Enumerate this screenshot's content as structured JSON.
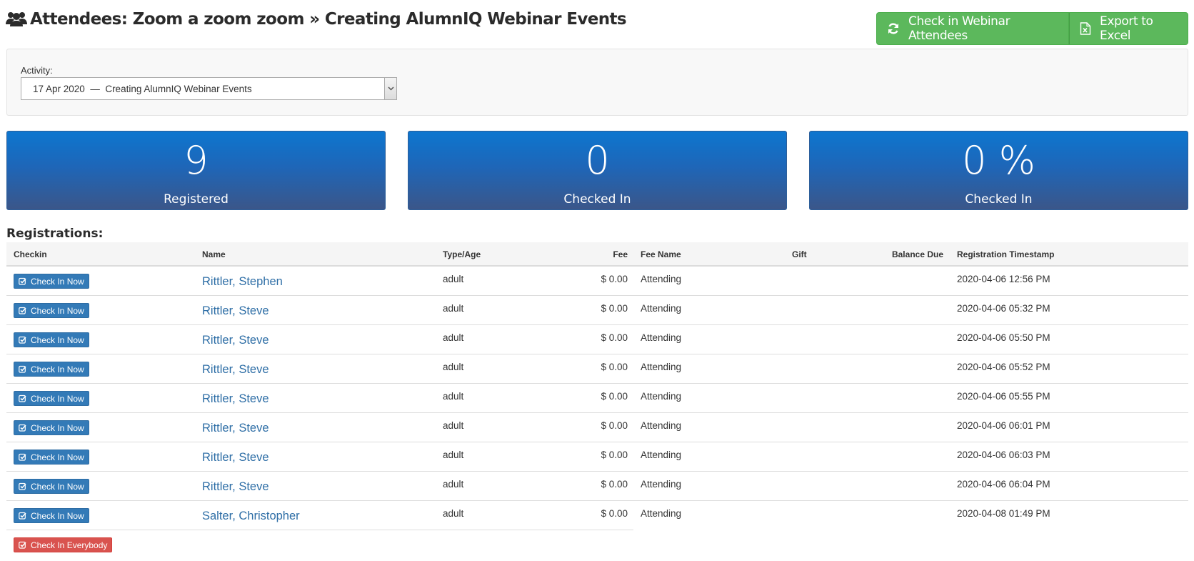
{
  "page": {
    "title": "Attendees: Zoom a zoom zoom » Creating AlumnIQ Webinar Events"
  },
  "actions": {
    "check_in_webinar": "Check in Webinar Attendees",
    "export_excel": "Export to Excel"
  },
  "activity": {
    "label": "Activity:",
    "selected": "17 Apr 2020  —  Creating AlumnIQ Webinar Events"
  },
  "stats": [
    {
      "value": "9",
      "label": "Registered"
    },
    {
      "value": "0",
      "label": "Checked In"
    },
    {
      "value": "0 %",
      "label": "Checked In"
    }
  ],
  "registrations": {
    "heading": "Registrations:",
    "columns": {
      "checkin": "Checkin",
      "name": "Name",
      "type": "Type/Age",
      "fee": "Fee",
      "fee_name": "Fee Name",
      "gift": "Gift",
      "balance": "Balance Due",
      "timestamp": "Registration Timestamp"
    },
    "check_in_label": "Check In Now",
    "check_in_everybody": "Check In Everybody",
    "rows": [
      {
        "name": "Rittler, Stephen",
        "type": "adult",
        "fee": "$ 0.00",
        "fee_name": "Attending",
        "gift": "",
        "balance": "",
        "timestamp": "2020-04-06 12:56 PM"
      },
      {
        "name": "Rittler, Steve",
        "type": "adult",
        "fee": "$ 0.00",
        "fee_name": "Attending",
        "gift": "",
        "balance": "",
        "timestamp": "2020-04-06 05:32 PM"
      },
      {
        "name": "Rittler, Steve",
        "type": "adult",
        "fee": "$ 0.00",
        "fee_name": "Attending",
        "gift": "",
        "balance": "",
        "timestamp": "2020-04-06 05:50 PM"
      },
      {
        "name": "Rittler, Steve",
        "type": "adult",
        "fee": "$ 0.00",
        "fee_name": "Attending",
        "gift": "",
        "balance": "",
        "timestamp": "2020-04-06 05:52 PM"
      },
      {
        "name": "Rittler, Steve",
        "type": "adult",
        "fee": "$ 0.00",
        "fee_name": "Attending",
        "gift": "",
        "balance": "",
        "timestamp": "2020-04-06 05:55 PM"
      },
      {
        "name": "Rittler, Steve",
        "type": "adult",
        "fee": "$ 0.00",
        "fee_name": "Attending",
        "gift": "",
        "balance": "",
        "timestamp": "2020-04-06 06:01 PM"
      },
      {
        "name": "Rittler, Steve",
        "type": "adult",
        "fee": "$ 0.00",
        "fee_name": "Attending",
        "gift": "",
        "balance": "",
        "timestamp": "2020-04-06 06:03 PM"
      },
      {
        "name": "Rittler, Steve",
        "type": "adult",
        "fee": "$ 0.00",
        "fee_name": "Attending",
        "gift": "",
        "balance": "",
        "timestamp": "2020-04-06 06:04 PM"
      },
      {
        "name": "Salter, Christopher",
        "type": "adult",
        "fee": "$ 0.00",
        "fee_name": "Attending",
        "gift": "",
        "balance": "",
        "timestamp": "2020-04-08 01:49 PM"
      }
    ]
  },
  "icons": {
    "title": "users-icon",
    "check_in_webinar": "refresh-icon",
    "export_excel": "excel-file-icon",
    "check_in": "checkbox-icon",
    "select_arrow": "chevron-down-icon"
  },
  "colors": {
    "green": "#5cb85c",
    "blue_button": "#337ab7",
    "red_button": "#d9534f",
    "stat_top": "#0d76cf",
    "stat_bottom": "#3b5689",
    "link": "#2e6ea6"
  }
}
